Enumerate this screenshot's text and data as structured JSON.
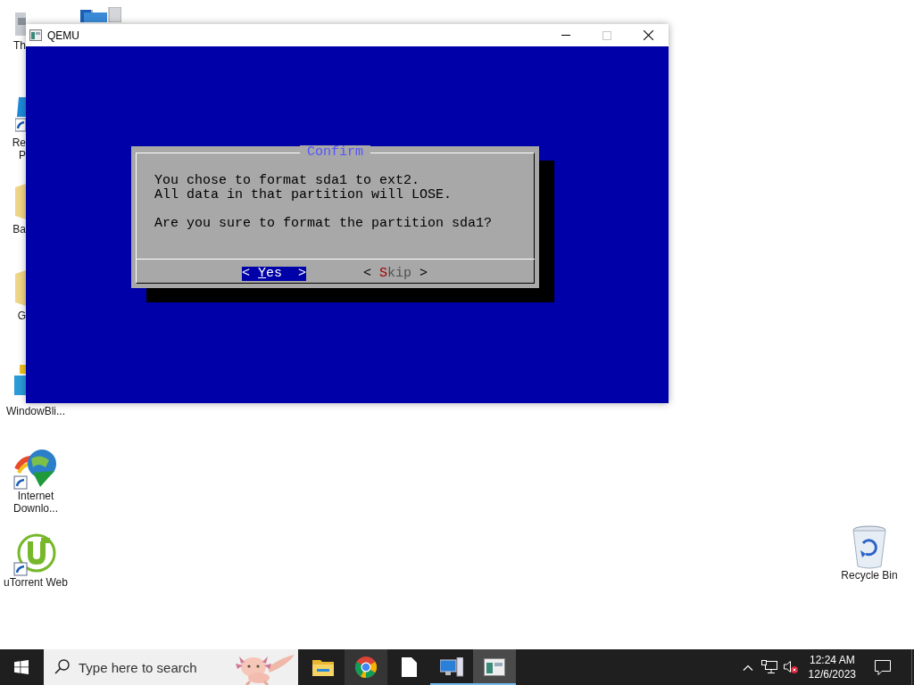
{
  "desktop": {
    "columns": [
      [
        {
          "kind": "computer",
          "label_lines": [
            "Th"
          ],
          "covered": true
        },
        {
          "kind": "shortcut",
          "label_lines": [
            "Re",
            "P"
          ],
          "covered": true
        },
        {
          "kind": "folder",
          "label_lines": [
            "Ba"
          ],
          "covered": true
        },
        {
          "kind": "folder",
          "label_lines": [
            "G"
          ],
          "covered": true
        },
        {
          "kind": "blinds",
          "label_lines": [
            "WindowBli..."
          ],
          "covered": false
        },
        {
          "kind": "downloader",
          "label_lines": [
            "Internet",
            "Downlo..."
          ],
          "covered": false
        },
        {
          "kind": "torrent",
          "label_lines": [
            "uTorrent Web"
          ],
          "covered": false
        }
      ],
      [
        {
          "kind": "monitor"
        }
      ]
    ],
    "right": [
      {
        "kind": "recycle",
        "label_lines": [
          "Recycle Bin"
        ],
        "covered": false
      }
    ]
  },
  "window": {
    "title": "QEMU",
    "maximize_disabled": true,
    "dialog": {
      "title": "Confirm",
      "paragraphs": [
        {
          "lines": [
            "You chose to format sda1 to ext2.",
            "All data in that partition will LOSE."
          ]
        },
        {
          "lines": [
            "Are you sure to format the partition sda1?"
          ]
        }
      ],
      "buttons": [
        {
          "open": "<",
          "hotkey": "Y",
          "rest": "es",
          "close": ">",
          "selected": true
        },
        {
          "open": "<",
          "hotkey": "S",
          "rest": "kip",
          "close": ">",
          "selected": false
        }
      ]
    }
  },
  "taskbar": {
    "search": {
      "placeholder": "Type here to search"
    },
    "apps": [
      {
        "kind": "explorer",
        "running": false,
        "active": false,
        "hovered": false
      },
      {
        "kind": "browser",
        "running": false,
        "active": false,
        "hovered": true
      },
      {
        "kind": "document",
        "running": false,
        "active": false,
        "hovered": false
      },
      {
        "kind": "monitor",
        "running": true,
        "active": false,
        "hovered": false
      },
      {
        "kind": "qemu",
        "running": true,
        "active": true,
        "hovered": false
      }
    ],
    "time": "12:24 AM",
    "date": "12/6/2023"
  }
}
